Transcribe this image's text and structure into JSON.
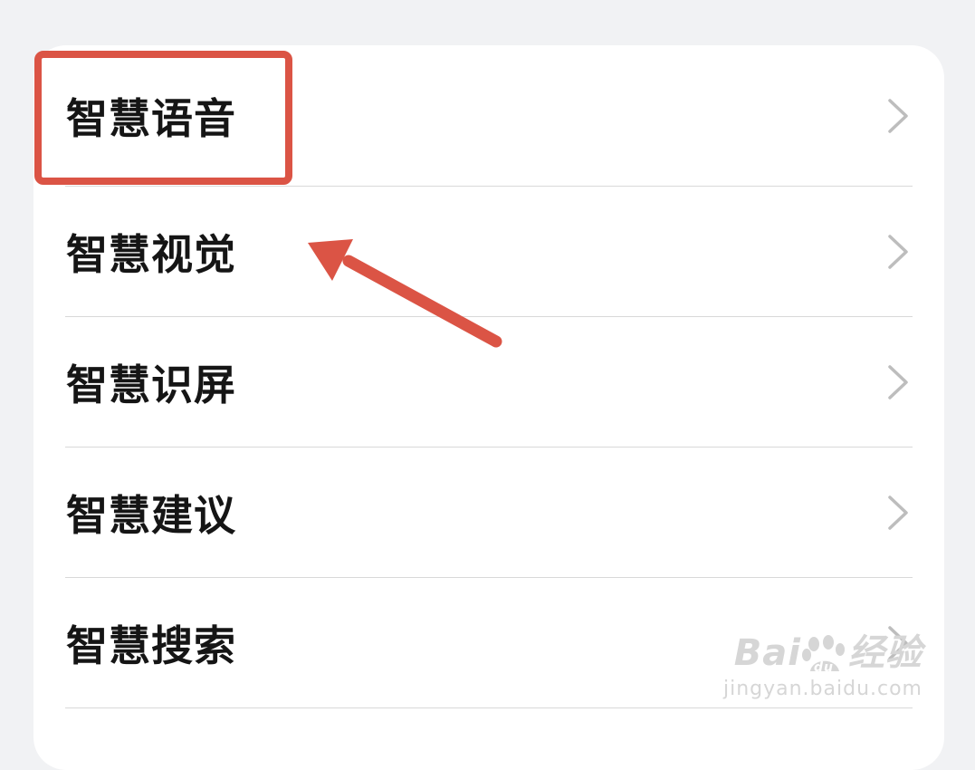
{
  "settings_list": {
    "items": [
      {
        "label": "智慧语音"
      },
      {
        "label": "智慧视觉"
      },
      {
        "label": "智慧识屏"
      },
      {
        "label": "智慧建议"
      },
      {
        "label": "智慧搜索"
      }
    ]
  },
  "annotation": {
    "highlight_color": "#db5445",
    "arrow_color": "#db5445"
  },
  "watermark": {
    "logo_text": "Bai",
    "logo_text_2": "经验",
    "logo_du": "du",
    "url": "jingyan.baidu.com"
  }
}
